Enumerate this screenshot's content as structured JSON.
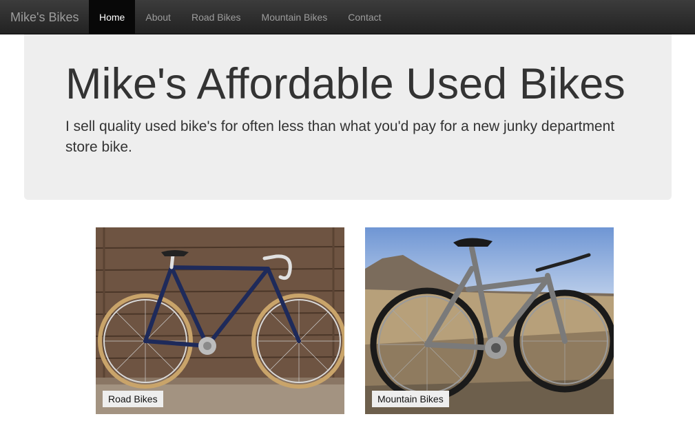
{
  "navbar": {
    "brand": "Mike's Bikes",
    "items": [
      {
        "label": "Home"
      },
      {
        "label": "About"
      },
      {
        "label": "Road Bikes"
      },
      {
        "label": "Mountain Bikes"
      },
      {
        "label": "Contact"
      }
    ]
  },
  "jumbotron": {
    "title": "Mike's Affordable Used Bikes",
    "lead": "I sell quality used bike's for often less than what you'd pay for a new junky department store bike."
  },
  "thumbnails": [
    {
      "caption": "Road Bikes"
    },
    {
      "caption": "Mountain Bikes"
    }
  ]
}
